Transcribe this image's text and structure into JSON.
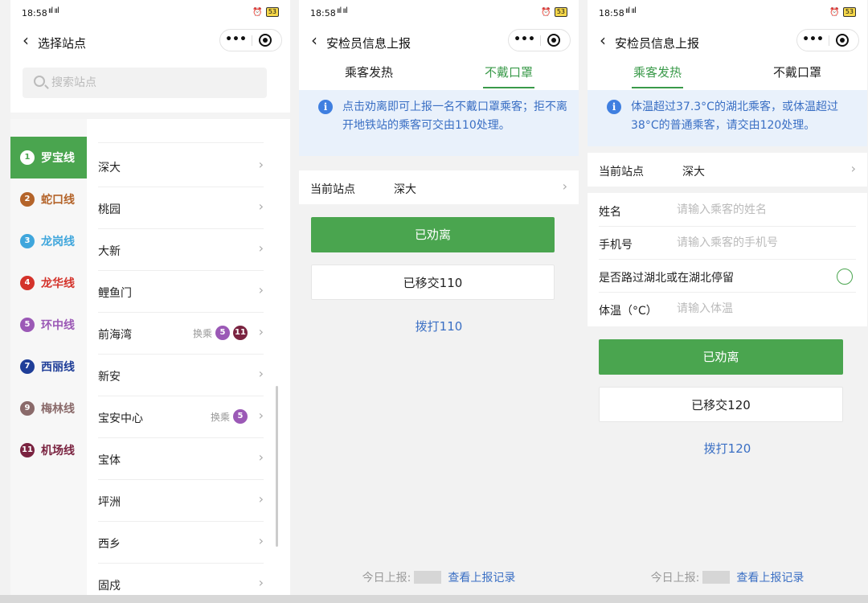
{
  "status": {
    "time": "18:58",
    "signal": "ııl ııl",
    "battery": "53"
  },
  "screen1": {
    "title": "选择站点",
    "search_placeholder": "搜索站点",
    "lines": [
      {
        "num": "1",
        "name": "罗宝线",
        "color": "#4aa54f"
      },
      {
        "num": "2",
        "name": "蛇口线",
        "color": "#b4642a"
      },
      {
        "num": "3",
        "name": "龙岗线",
        "color": "#3fa6dc"
      },
      {
        "num": "4",
        "name": "龙华线",
        "color": "#d4332b"
      },
      {
        "num": "5",
        "name": "环中线",
        "color": "#9b59b6"
      },
      {
        "num": "7",
        "name": "西丽线",
        "color": "#1f3e98"
      },
      {
        "num": "9",
        "name": "梅林线",
        "color": "#8a6a6a"
      },
      {
        "num": "11",
        "name": "机场线",
        "color": "#7a2340"
      }
    ],
    "stations": [
      "深大",
      "桃园",
      "大新",
      "鲤鱼门",
      "前海湾",
      "新安",
      "宝安中心",
      "宝体",
      "坪洲",
      "西乡",
      "固戍"
    ],
    "transfer_label": "换乘"
  },
  "report": {
    "title": "安检员信息上报",
    "tab_fever": "乘客发热",
    "tab_mask": "不戴口罩",
    "notice_mask": "点击劝离即可上报一名不戴口罩乘客；拒不离开地铁站的乘客可交由110处理。",
    "notice_fever": "体温超过37.3°C的湖北乘客，或体温超过38°C的普通乘客，请交由120处理。",
    "station_label": "当前站点",
    "station_value": "深大",
    "btn_dissuaded": "已劝离",
    "btn_transfer_110": "已移交110",
    "call_110": "拨打110",
    "btn_transfer_120": "已移交120",
    "call_120": "拨打120",
    "today_label": "今日上报:",
    "records_link": "查看上报记录",
    "form": {
      "name_label": "姓名",
      "name_placeholder": "请输入乘客的姓名",
      "phone_label": "手机号",
      "phone_placeholder": "请输入乘客的手机号",
      "hubei_label": "是否路过湖北或在湖北停留",
      "temp_label": "体温（°C）",
      "temp_placeholder": "请输入体温"
    }
  }
}
